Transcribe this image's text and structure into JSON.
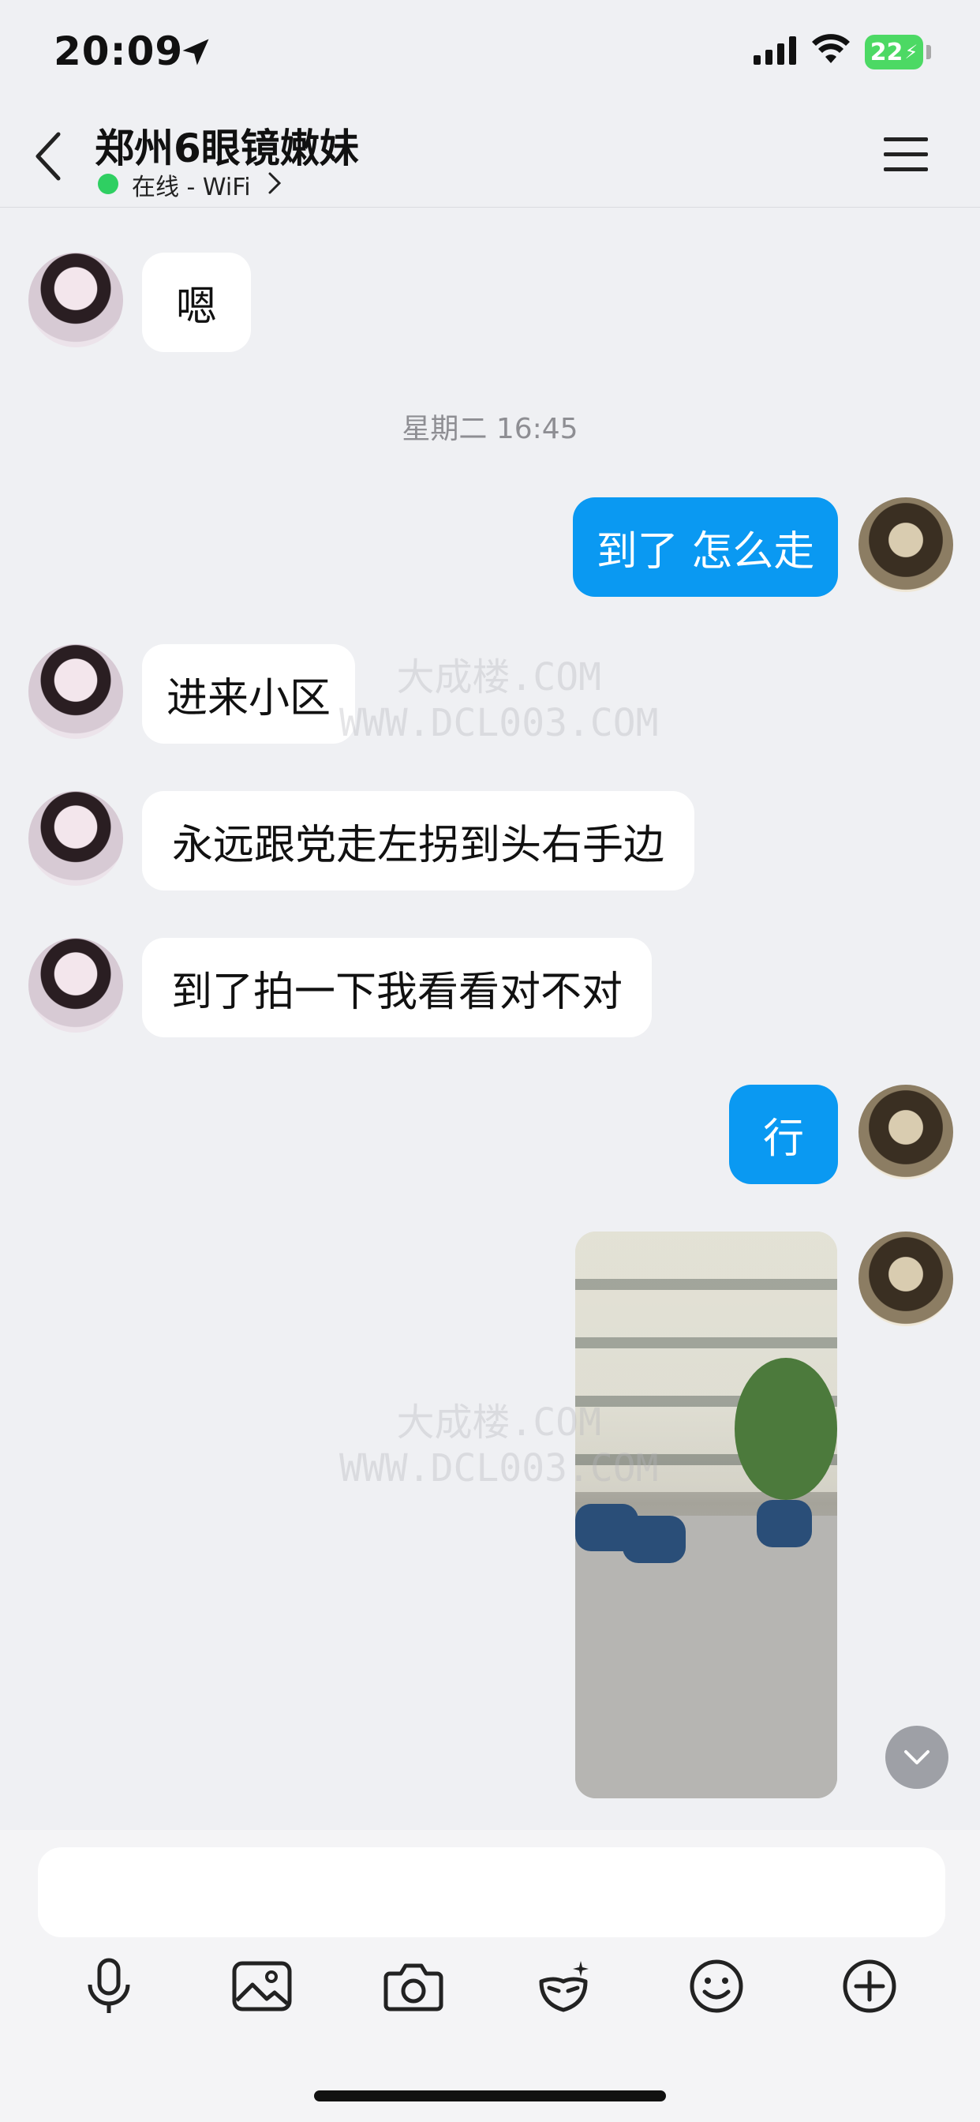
{
  "status_bar": {
    "time": "20:09",
    "battery": "22"
  },
  "header": {
    "title": "郑州6眼镜嫩妹",
    "status": "在线 - WiFi"
  },
  "messages": [
    {
      "sender": "peer",
      "text": "嗯"
    },
    {
      "sender": "me",
      "text": "到了 怎么走"
    },
    {
      "sender": "peer",
      "text": "进来小区"
    },
    {
      "sender": "peer",
      "text": "永远跟党走左拐到头右手边"
    },
    {
      "sender": "peer",
      "text": "到了拍一下我看看对不对"
    },
    {
      "sender": "me",
      "text": "行"
    }
  ],
  "timestamp": "星期二 16:45",
  "watermark": {
    "line1": "大成楼.COM",
    "line2": "WWW.DCL003.COM"
  },
  "toolbar": [
    "microphone-icon",
    "image-icon",
    "camera-icon",
    "sticker-icon",
    "emoji-icon",
    "plus-icon"
  ],
  "colors": {
    "outgoing_bubble": "#0a99f2",
    "incoming_bubble": "#ffffff",
    "online": "#2fcf62",
    "battery": "#4cd964"
  }
}
